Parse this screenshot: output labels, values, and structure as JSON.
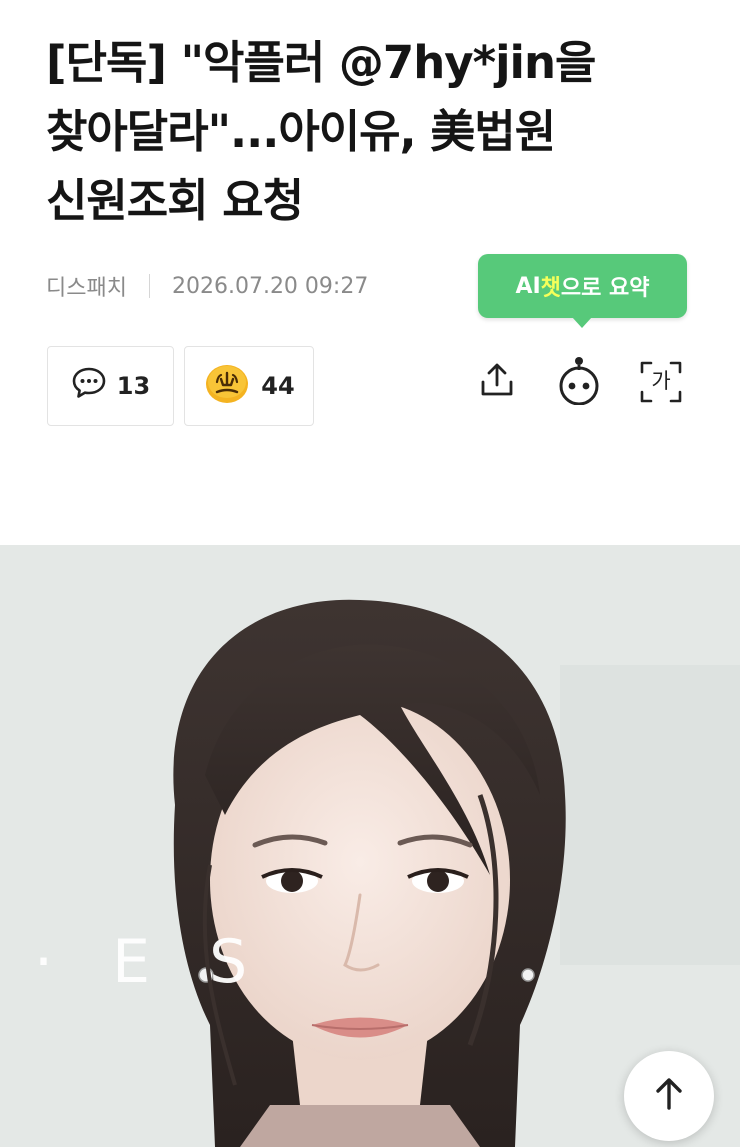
{
  "article": {
    "title_line1": "[단독] \"악플러 @7hy*jin을",
    "title_line2": "찾아달라\"...아이유, 美법원",
    "title_line3": "신원조회 요청",
    "source": "디스패치",
    "datetime": "2026.07.20 09:27"
  },
  "ai_summary": {
    "prefix": "AI",
    "highlight": "챗",
    "suffix": "으로 요약"
  },
  "engagement": {
    "comment_count": "13",
    "reaction_count": "44"
  },
  "tools": {
    "font_size_label": "가"
  },
  "photo_background_text": "· E S",
  "icons": [
    "comment-icon",
    "reaction-emoji-icon",
    "share-icon",
    "ai-bot-icon",
    "font-size-icon",
    "arrow-up-icon"
  ],
  "colors": {
    "ai_bubble": "#57c97a",
    "ai_highlight": "#f5ff5a",
    "meta_text": "#8a8a8a"
  }
}
